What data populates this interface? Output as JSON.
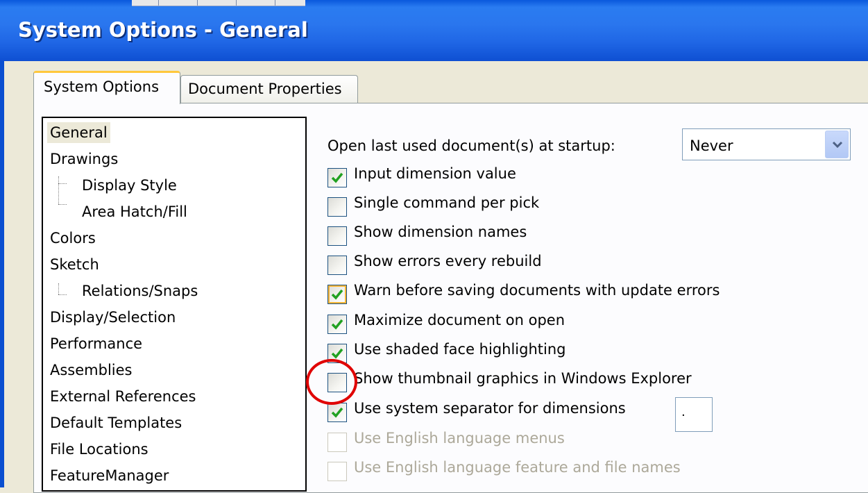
{
  "window": {
    "title": "System Options - General"
  },
  "tabs": [
    {
      "label": "System Options",
      "mnemonic_index": 0,
      "active": true
    },
    {
      "label": "Document Properties",
      "mnemonic_index": 0,
      "active": false
    }
  ],
  "tree": [
    {
      "label": "General",
      "level": 0,
      "selected": true
    },
    {
      "label": "Drawings",
      "level": 0
    },
    {
      "label": "Display Style",
      "level": 1
    },
    {
      "label": "Area Hatch/Fill",
      "level": 1
    },
    {
      "label": "Colors",
      "level": 0
    },
    {
      "label": "Sketch",
      "level": 0
    },
    {
      "label": "Relations/Snaps",
      "level": 1
    },
    {
      "label": "Display/Selection",
      "level": 0
    },
    {
      "label": "Performance",
      "level": 0
    },
    {
      "label": "Assemblies",
      "level": 0
    },
    {
      "label": "External References",
      "level": 0
    },
    {
      "label": "Default Templates",
      "level": 0
    },
    {
      "label": "File Locations",
      "level": 0
    },
    {
      "label": "FeatureManager",
      "level": 0
    }
  ],
  "open_last": {
    "label": "Open last used document(s) at startup:",
    "value": "Never"
  },
  "options": [
    {
      "label": "Input dimension value",
      "checked": true,
      "enabled": true
    },
    {
      "label": "Single command per pick",
      "checked": false,
      "enabled": true
    },
    {
      "label": "Show dimension names",
      "checked": false,
      "enabled": true
    },
    {
      "label": "Show errors every rebuild",
      "checked": false,
      "enabled": true
    },
    {
      "label": "Warn before saving documents with update errors",
      "checked": true,
      "enabled": true,
      "focused": true
    },
    {
      "label": "Maximize document on open",
      "checked": true,
      "enabled": true
    },
    {
      "label": "Use shaded face highlighting",
      "checked": true,
      "enabled": true
    },
    {
      "label": "Show thumbnail graphics in Windows Explorer",
      "checked": false,
      "enabled": true,
      "annotated": true
    },
    {
      "label": "Use system separator for dimensions",
      "checked": true,
      "enabled": true
    },
    {
      "label": "Use English language menus",
      "checked": false,
      "enabled": false
    },
    {
      "label": "Use English language feature and file names",
      "checked": false,
      "enabled": false
    }
  ],
  "separator": {
    "value": "."
  },
  "colors": {
    "check": "#21a121",
    "annotation": "#e00000",
    "focus": "#f8b636"
  }
}
